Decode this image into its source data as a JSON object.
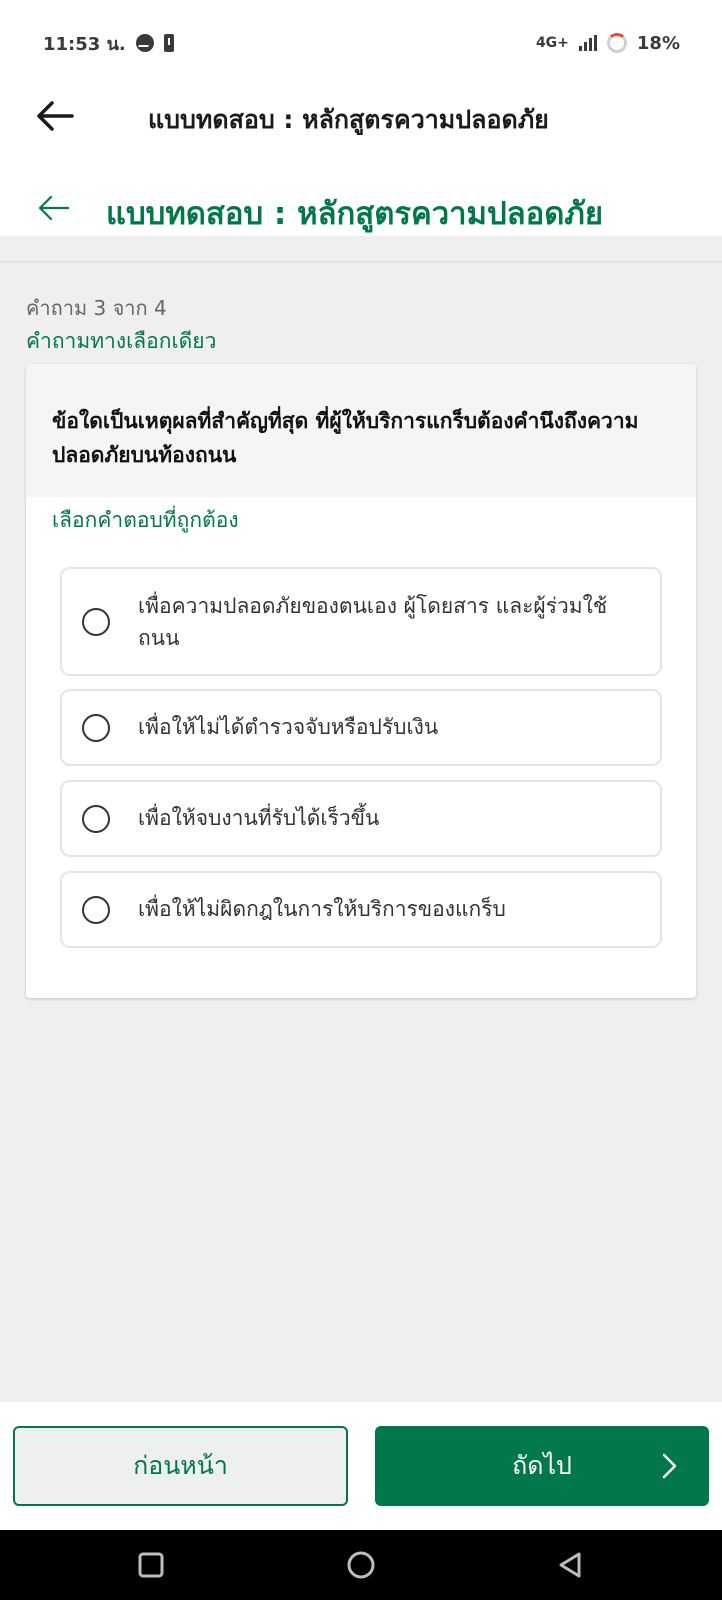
{
  "status_bar": {
    "time": "11:53 น.",
    "network": "4G+",
    "battery": "18%",
    "icons": [
      "messenger-icon",
      "battery-alert-icon",
      "signal-icon",
      "battery-ring-icon"
    ]
  },
  "header": {
    "title": "แบบทดสอบ : หลักสูตรความปลอดภัย",
    "subtitle": "แบบทดสอบ : หลักสูตรความปลอดภัย",
    "back_icon": "arrow-left-icon"
  },
  "question": {
    "counter": "คำถาม 3 จาก 4",
    "type": "คำถามทางเลือกเดียว",
    "text": "ข้อใดเป็นเหตุผลที่สำคัญที่สุด ที่ผู้ให้บริการแกร็บต้องคำนึงถึงความปลอดภัยบนท้องถนน",
    "instruction": "เลือกคำตอบที่ถูกต้อง",
    "options": [
      {
        "label": "เพื่อความปลอดภัยของตนเอง ผู้โดยสาร และผู้ร่วมใช้ถนน",
        "selected": false
      },
      {
        "label": "เพื่อให้ไม่ได้ตำรวจจับหรือปรับเงิน",
        "selected": false
      },
      {
        "label": "เพื่อให้จบงานที่รับได้เร็วขึ้น",
        "selected": false
      },
      {
        "label": "เพื่อให้ไม่ผิดกฎในการให้บริการของแกร็บ",
        "selected": false
      }
    ]
  },
  "actions": {
    "prev_label": "ก่อนหน้า",
    "next_label": "ถัดไป"
  },
  "colors": {
    "brand": "#00784a",
    "background": "#efefef",
    "card": "#ffffff"
  }
}
